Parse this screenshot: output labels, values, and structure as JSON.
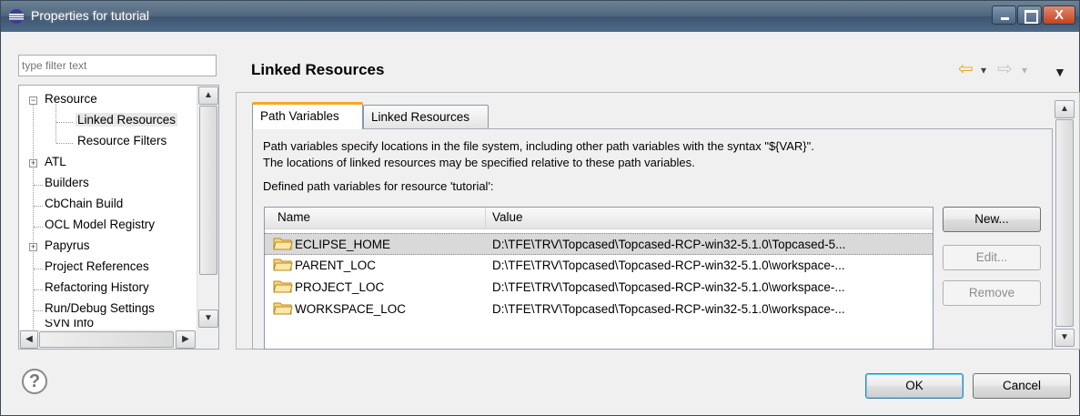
{
  "window": {
    "title": "Properties for tutorial"
  },
  "filter": {
    "placeholder": "type filter text"
  },
  "tree": {
    "items": [
      {
        "label": "Resource",
        "expander": "⊟"
      },
      {
        "label": "Linked Resources"
      },
      {
        "label": "Resource Filters"
      },
      {
        "label": "ATL",
        "expander": "⊞"
      },
      {
        "label": "Builders"
      },
      {
        "label": "CbChain Build"
      },
      {
        "label": "OCL Model Registry"
      },
      {
        "label": "Papyrus",
        "expander": "⊞"
      },
      {
        "label": "Project References"
      },
      {
        "label": "Refactoring History"
      },
      {
        "label": "Run/Debug Settings"
      },
      {
        "label": "SVN Info"
      }
    ]
  },
  "page": {
    "title": "Linked Resources"
  },
  "tabs": [
    {
      "label": "Path Variables",
      "active": true
    },
    {
      "label": "Linked Resources",
      "active": false
    }
  ],
  "description": {
    "line1": "Path variables specify locations in the file system, including other path variables with the syntax \"${VAR}\".",
    "line2": "The locations of linked resources may be specified relative to these path variables."
  },
  "defined_label": "Defined path variables for resource 'tutorial':",
  "table": {
    "columns": [
      "Name",
      "Value"
    ],
    "rows": [
      {
        "name": "ECLIPSE_HOME",
        "value": "D:\\TFE\\TRV\\Topcased\\Topcased-RCP-win32-5.1.0\\Topcased-5..."
      },
      {
        "name": "PARENT_LOC",
        "value": "D:\\TFE\\TRV\\Topcased\\Topcased-RCP-win32-5.1.0\\workspace-..."
      },
      {
        "name": "PROJECT_LOC",
        "value": "D:\\TFE\\TRV\\Topcased\\Topcased-RCP-win32-5.1.0\\workspace-..."
      },
      {
        "name": "WORKSPACE_LOC",
        "value": "D:\\TFE\\TRV\\Topcased\\Topcased-RCP-win32-5.1.0\\workspace-..."
      }
    ]
  },
  "buttons": {
    "new": "New...",
    "edit": "Edit...",
    "remove": "Remove",
    "ok": "OK",
    "cancel": "Cancel"
  },
  "icons": {
    "help": "?",
    "close": "X",
    "back": "⇦",
    "forward": "⇨",
    "menu": "▼",
    "dropdown": "▾"
  },
  "colors": {
    "title_bar": "#50667e",
    "close_button": "#c4431c",
    "tab_accent": "#f5a623",
    "selection": "#d9d9d9",
    "folder": "#e6b84a"
  }
}
